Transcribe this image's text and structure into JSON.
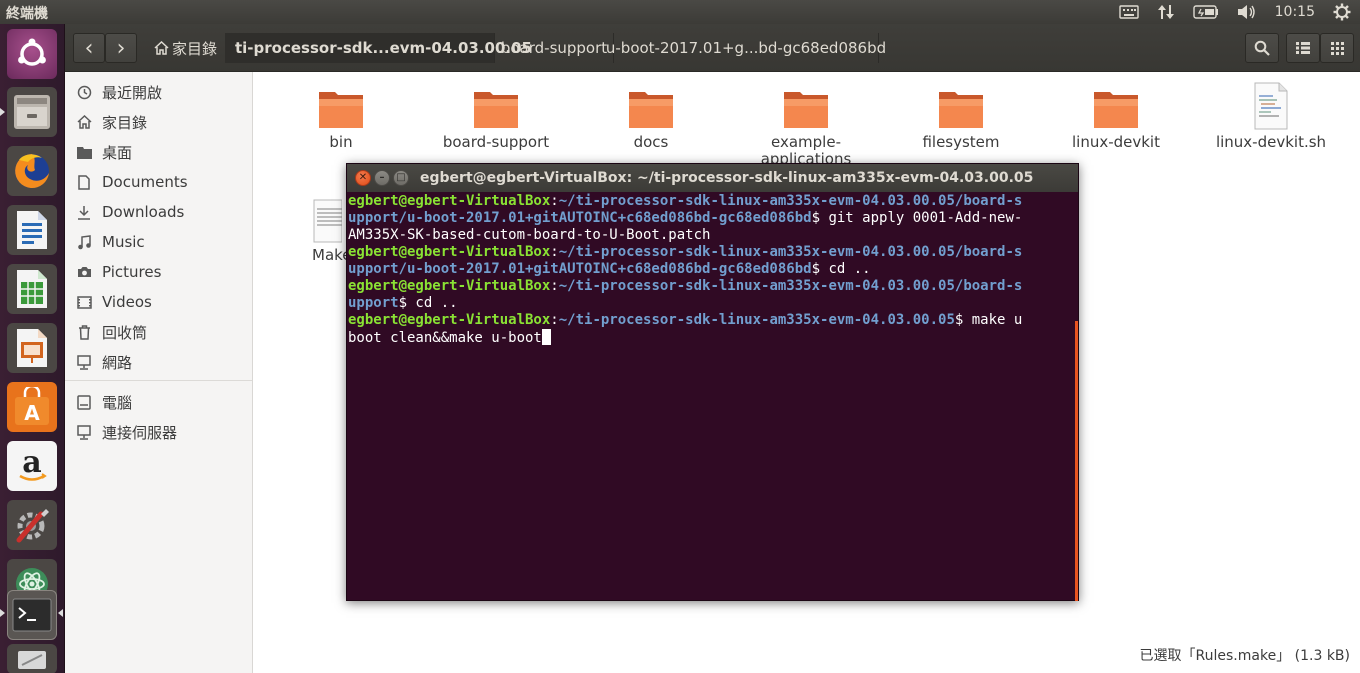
{
  "top_panel": {
    "app_title": "終端機",
    "clock": "10:15",
    "indicators": [
      "keyboard-icon",
      "network-updown-icon",
      "battery-icon",
      "volume-icon",
      "power-gear-icon"
    ]
  },
  "launcher": {
    "items": [
      "ubuntu-dash-icon",
      "files-icon",
      "firefox-icon",
      "writer-icon",
      "calc-icon",
      "impress-icon",
      "software-center-icon",
      "amazon-icon",
      "system-settings-icon",
      "atom-icon",
      "terminal-icon",
      "misc-icon"
    ]
  },
  "file_manager": {
    "nav": {
      "back": "‹",
      "forward": "›"
    },
    "breadcrumbs": [
      {
        "label": "家目錄",
        "icon": "home-icon"
      },
      {
        "label": "ti-processor-sdk...evm-04.03.00.05"
      },
      {
        "label": "board-support"
      },
      {
        "label": "u-boot-2017.01+g...bd-gc68ed086bd"
      }
    ],
    "sidebar": [
      {
        "label": "最近開啟",
        "icon": "clock-icon"
      },
      {
        "label": "家目錄",
        "icon": "home-icon"
      },
      {
        "label": "桌面",
        "icon": "folder-icon"
      },
      {
        "label": "Documents",
        "icon": "document-icon"
      },
      {
        "label": "Downloads",
        "icon": "download-icon"
      },
      {
        "label": "Music",
        "icon": "music-icon"
      },
      {
        "label": "Pictures",
        "icon": "camera-icon"
      },
      {
        "label": "Videos",
        "icon": "video-icon"
      },
      {
        "label": "回收筒",
        "icon": "trash-icon"
      },
      {
        "label": "網路",
        "icon": "network-icon"
      },
      {
        "label": "電腦",
        "icon": "computer-icon"
      },
      {
        "label": "連接伺服器",
        "icon": "server-icon"
      }
    ],
    "files": [
      {
        "name": "bin",
        "type": "folder"
      },
      {
        "name": "board-support",
        "type": "folder"
      },
      {
        "name": "docs",
        "type": "folder"
      },
      {
        "name": "example-applications",
        "line1": "example-",
        "line2": "applications",
        "type": "folder"
      },
      {
        "name": "filesystem",
        "type": "folder"
      },
      {
        "name": "linux-devkit",
        "type": "folder"
      },
      {
        "name": "linux-devkit.sh",
        "type": "script"
      },
      {
        "name": "Make",
        "type": "text"
      }
    ],
    "status": "已選取「Rules.make」 (1.3 kB)"
  },
  "terminal": {
    "title": "egbert@egbert-VirtualBox: ~/ti-processor-sdk-linux-am335x-evm-04.03.00.05",
    "lines": [
      [
        {
          "t": "egbert@egbert-VirtualBox",
          "c": "user"
        },
        {
          "t": ":",
          "c": "plain"
        },
        {
          "t": "~/ti-processor-sdk-linux-am335x-evm-04.03.00.05/board-s",
          "c": "path"
        }
      ],
      [
        {
          "t": "upport/u-boot-2017.01+gitAUTOINC+c68ed086bd-gc68ed086bd",
          "c": "path"
        },
        {
          "t": "$ git apply 0001-Add-new-",
          "c": "plain"
        }
      ],
      [
        {
          "t": "AM335X-SK-based-cutom-board-to-U-Boot.patch",
          "c": "plain"
        }
      ],
      [
        {
          "t": "egbert@egbert-VirtualBox",
          "c": "user"
        },
        {
          "t": ":",
          "c": "plain"
        },
        {
          "t": "~/ti-processor-sdk-linux-am335x-evm-04.03.00.05/board-s",
          "c": "path"
        }
      ],
      [
        {
          "t": "upport/u-boot-2017.01+gitAUTOINC+c68ed086bd-gc68ed086bd",
          "c": "path"
        },
        {
          "t": "$ cd ..",
          "c": "plain"
        }
      ],
      [
        {
          "t": "egbert@egbert-VirtualBox",
          "c": "user"
        },
        {
          "t": ":",
          "c": "plain"
        },
        {
          "t": "~/ti-processor-sdk-linux-am335x-evm-04.03.00.05/board-s",
          "c": "path"
        }
      ],
      [
        {
          "t": "upport",
          "c": "path"
        },
        {
          "t": "$ cd ..",
          "c": "plain"
        }
      ],
      [
        {
          "t": "egbert@egbert-VirtualBox",
          "c": "user"
        },
        {
          "t": ":",
          "c": "plain"
        },
        {
          "t": "~/ti-processor-sdk-linux-am335x-evm-04.03.00.05",
          "c": "path"
        },
        {
          "t": "$ make u",
          "c": "plain"
        }
      ],
      [
        {
          "t": "boot clean&&make u-boot",
          "c": "plain"
        },
        {
          "t": "",
          "c": "cursor"
        }
      ]
    ]
  },
  "colors": {
    "terminal_bg": "#300a24",
    "prompt_user": "#8ae234",
    "prompt_path": "#729fcf",
    "accent_orange": "#e95420"
  }
}
